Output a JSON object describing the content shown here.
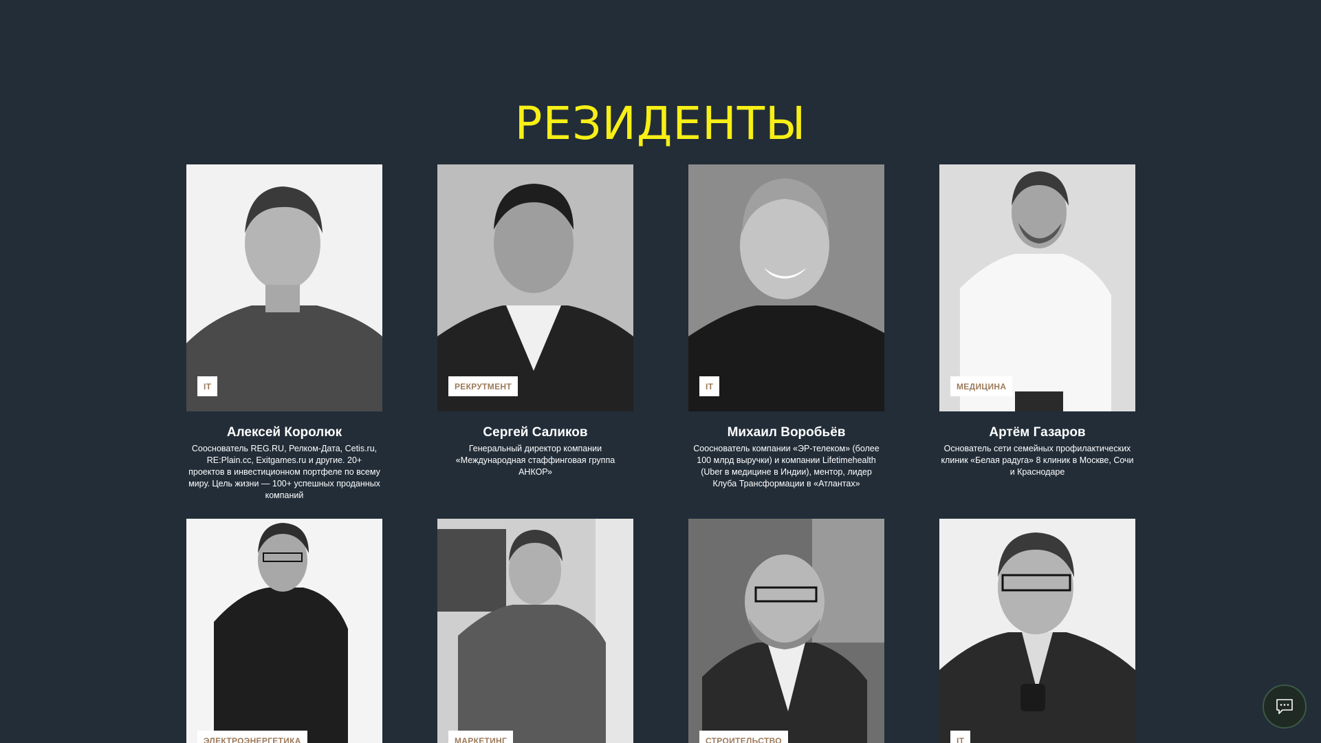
{
  "section": {
    "title": "РЕЗИДЕНТЫ"
  },
  "residents": [
    {
      "tag": "IT",
      "name": "Алексей Королюк",
      "description": "Сооснователь REG.RU, Релком-Дата, Cetis.ru, RE:Plain.cc, Exitgames.ru и другие. 20+ проектов в инвестиционном портфеле по всему миру. Цель жизни — 100+ успешных проданных компаний"
    },
    {
      "tag": "РЕКРУТМЕНТ",
      "name": "Сергей Саликов",
      "description": "Генеральный директор компании «Международная стаффинговая группа АНКОР»"
    },
    {
      "tag": "IT",
      "name": "Михаил Воробьёв",
      "description": "Сооснователь компании «ЭР-телеком» (более 100 млрд выручки) и компании Lifetimehealth (Uber в медицине в Индии), ментор, лидер Клуба Трансформации в «Атлантах»"
    },
    {
      "tag": "МЕДИЦИНА",
      "name": "Артём Газаров",
      "description": "Основатель сети семейных профилактических клиник «Белая радуга» 8 клиник в Москве, Сочи и Краснодаре"
    },
    {
      "tag": "ЭЛЕКТРОЭНЕРГЕТИКА",
      "name": "",
      "description": ""
    },
    {
      "tag": "МАРКЕТИНГ",
      "name": "",
      "description": ""
    },
    {
      "tag": "СТРОИТЕЛЬСТВО",
      "name": "",
      "description": ""
    },
    {
      "tag": "IT",
      "name": "",
      "description": ""
    }
  ],
  "chat_widget": {
    "icon": "chat-bubble-icon"
  },
  "colors": {
    "background": "#222d38",
    "title": "#f7ef16",
    "tag_text": "#9c7a5a"
  }
}
